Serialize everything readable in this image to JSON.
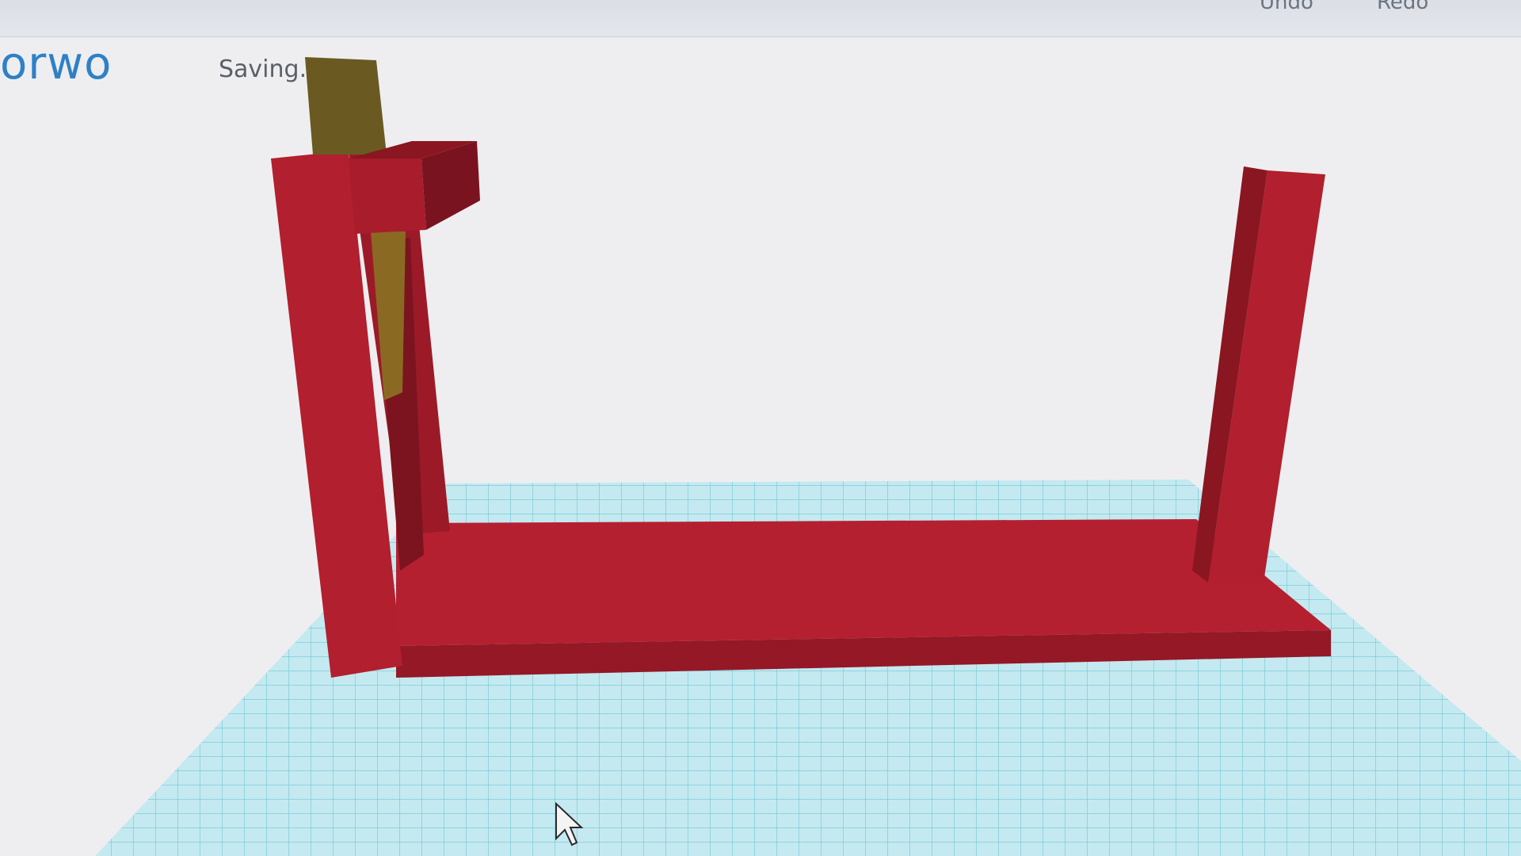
{
  "toolbar": {
    "undo_label": "Undo",
    "redo_label": "Redo"
  },
  "project": {
    "title": "orwo",
    "status": "Saving..."
  },
  "colors": {
    "workplane": "#bfe6ee",
    "grid_line": "#59c2d2",
    "model": "#b21f2e",
    "model_shadow": "#8a1621",
    "slot_insert": "#6a5a22"
  },
  "icons": {
    "cursor": "mouse-pointer-icon"
  }
}
